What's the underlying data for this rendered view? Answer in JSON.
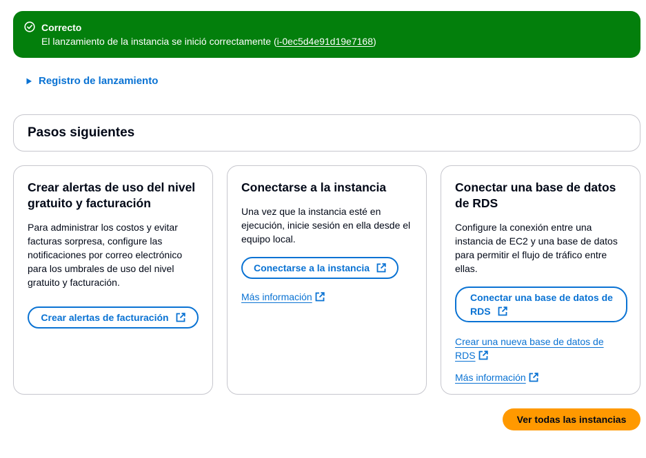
{
  "flash": {
    "title": "Correcto",
    "message_prefix": "El lanzamiento de la instancia se inició correctamente (",
    "instance_id": "i-0ec5d4e91d19e7168",
    "message_suffix": ")"
  },
  "launch_log": {
    "label": "Registro de lanzamiento"
  },
  "next_steps": {
    "title": "Pasos siguientes"
  },
  "cards": [
    {
      "title": "Crear alertas de uso del nivel gratuito y facturación",
      "body": "Para administrar los costos y evitar facturas sorpresa, configure las notificaciones por correo electrónico para los umbrales de uso del nivel gratuito y facturación.",
      "button": "Crear alertas de facturación"
    },
    {
      "title": "Conectarse a la instancia",
      "body": "Una vez que la instancia esté en ejecución, inicie sesión en ella desde el equipo local.",
      "button": "Conectarse a la instancia",
      "link": "Más información"
    },
    {
      "title": "Conectar una base de datos de RDS",
      "body": "Configure la conexión entre una instancia de EC2 y una base de datos para permitir el flujo de tráfico entre ellas.",
      "button_line1": "Conectar una base de datos de",
      "button_line2": "RDS",
      "link1_line1": "Crear una nueva base de datos de",
      "link1_line2": "RDS",
      "link2": "Más información"
    }
  ],
  "footer": {
    "view_all": "Ver todas las instancias"
  },
  "colors": {
    "success": "#037f0c",
    "link": "#0972d3",
    "primary": "#ff9900",
    "border": "#c6c6cd"
  }
}
